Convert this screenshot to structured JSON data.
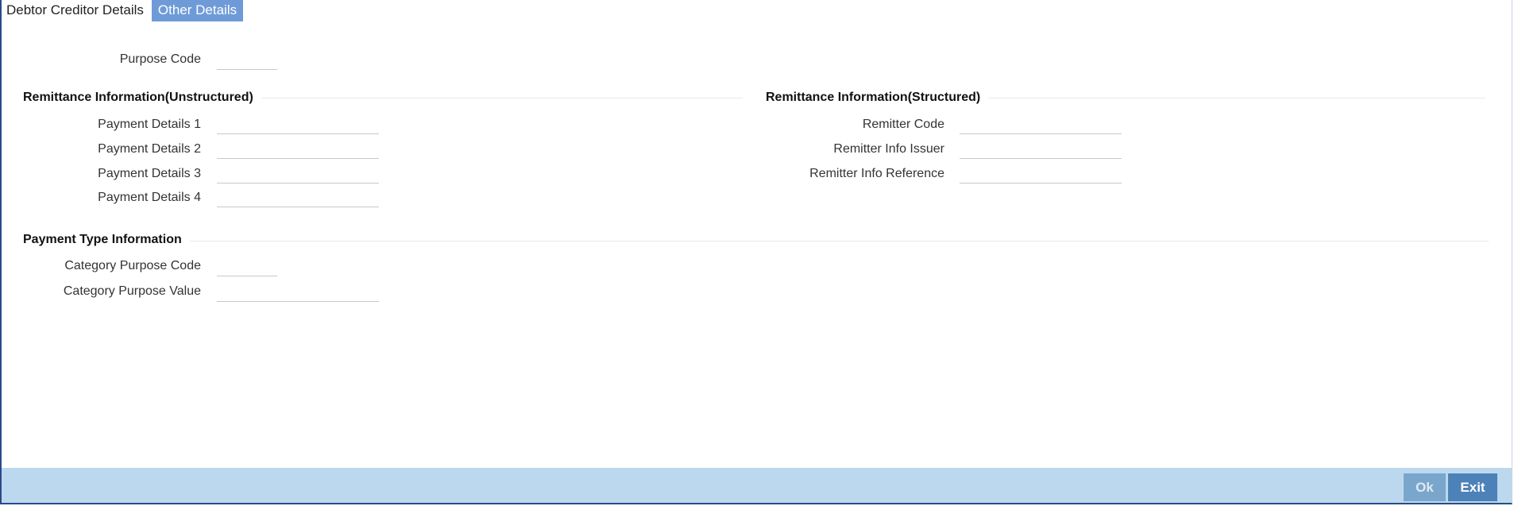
{
  "tabs": [
    {
      "label": "Debtor Creditor Details",
      "active": false
    },
    {
      "label": "Other Details",
      "active": true
    }
  ],
  "purpose_code": {
    "label": "Purpose Code",
    "value": ""
  },
  "remittance_unstructured": {
    "title": "Remittance Information(Unstructured)",
    "fields": [
      {
        "label": "Payment Details 1",
        "value": ""
      },
      {
        "label": "Payment Details 2",
        "value": ""
      },
      {
        "label": "Payment Details 3",
        "value": ""
      },
      {
        "label": "Payment Details 4",
        "value": ""
      }
    ]
  },
  "remittance_structured": {
    "title": "Remittance Information(Structured)",
    "fields": [
      {
        "label": "Remitter Code",
        "value": ""
      },
      {
        "label": "Remitter Info Issuer",
        "value": ""
      },
      {
        "label": "Remitter Info Reference",
        "value": ""
      }
    ]
  },
  "payment_type": {
    "title": "Payment Type Information",
    "fields": [
      {
        "label": "Category Purpose Code",
        "value": ""
      },
      {
        "label": "Category Purpose Value",
        "value": ""
      }
    ]
  },
  "footer": {
    "ok_label": "Ok",
    "exit_label": "Exit"
  },
  "colors": {
    "active_tab": "#6e9bd8",
    "footer_bg": "#bcd8ee",
    "exit_button": "#4d82b8",
    "ok_button_disabled": "#7aa6cc",
    "frame_border": "#2a4a8a"
  }
}
